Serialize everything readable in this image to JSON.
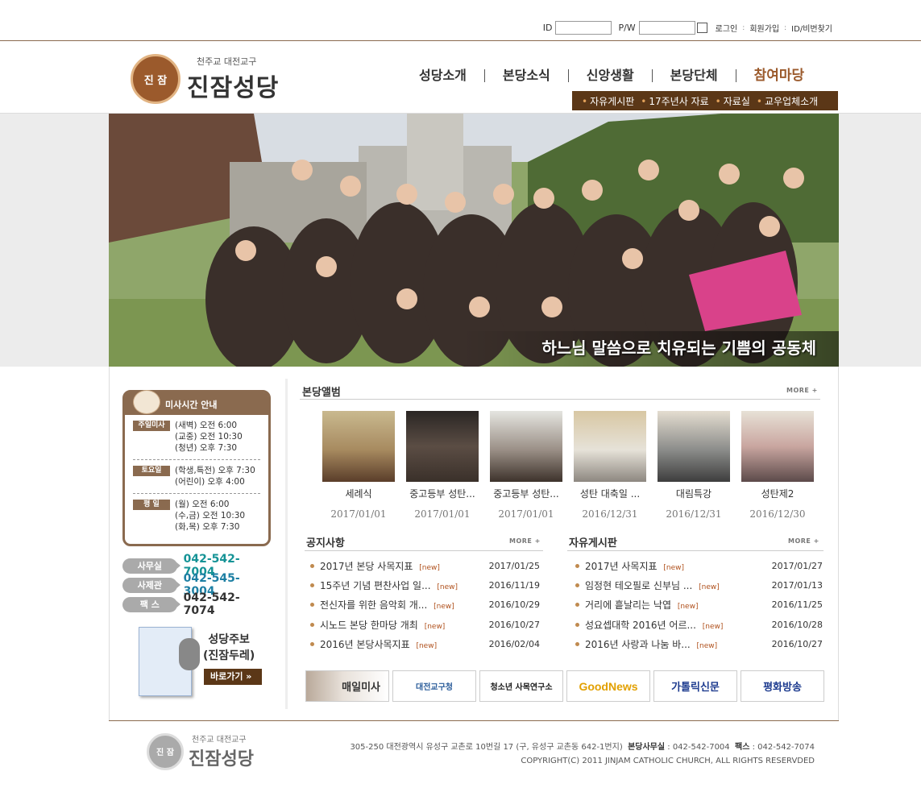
{
  "login": {
    "id_label": "ID",
    "pw_label": "P/W",
    "login": "로그인",
    "join": "회원가입",
    "find": "ID/비번찾기",
    "sep": ":"
  },
  "logo": {
    "sub": "천주교 대전교구",
    "name": "진잠성당",
    "mark": "진 잠"
  },
  "gnb": [
    "성당소개",
    "본당소식",
    "신앙생활",
    "본당단체",
    "참여마당"
  ],
  "subnav": [
    "자유게시판",
    "17주년사 자료",
    "자료실",
    "교우업체소개"
  ],
  "hero": {
    "caption": "하느님 말씀으로 치유되는 기쁨의 공동체"
  },
  "mass": {
    "title": "미사시간 안내",
    "blocks": [
      {
        "tag": "주일미사",
        "lines": [
          "(새벽) 오전 6:00",
          "(교중) 오전 10:30",
          "(청년) 오후 7:30"
        ]
      },
      {
        "tag": "토요일",
        "lines": [
          "(학생,특전) 오후 7:30",
          "(어린이) 오후 4:00"
        ]
      },
      {
        "tag": "평 일",
        "lines": [
          "(월) 오전 6:00",
          "(수,금) 오전 10:30",
          "(화,목) 오후 7:30"
        ]
      }
    ]
  },
  "contact": [
    {
      "label": "사무실",
      "number": "042-542-7004",
      "color": "#159396"
    },
    {
      "label": "사제관",
      "number": "042-545-3004",
      "color": "#1d7fa3"
    },
    {
      "label": "팩 스",
      "number": "042-542-7074",
      "color": "#333333"
    }
  ],
  "bulletin": {
    "title1": "성당주보",
    "title2": "(진잠두레)",
    "button": "바로가기 »"
  },
  "album": {
    "title": "본당앨범",
    "more": "MORE +",
    "items": [
      {
        "caption": "세례식",
        "date": "2017/01/01"
      },
      {
        "caption": "중고등부 성탄...",
        "date": "2017/01/01"
      },
      {
        "caption": "중고등부 성탄...",
        "date": "2017/01/01"
      },
      {
        "caption": "성탄 대축일 ...",
        "date": "2016/12/31"
      },
      {
        "caption": "대림특강",
        "date": "2016/12/31"
      },
      {
        "caption": "성탄제2",
        "date": "2016/12/30"
      }
    ]
  },
  "notice": {
    "title": "공지사항",
    "more": "MORE +",
    "items": [
      {
        "title": "2017년 본당 사목지표",
        "new": "[new]",
        "date": "2017/01/25"
      },
      {
        "title": "15주년 기념 편찬사업 일...",
        "new": "[new]",
        "date": "2016/11/19"
      },
      {
        "title": "전신자를 위한 음악회 개...",
        "new": "[new]",
        "date": "2016/10/29"
      },
      {
        "title": "시노드 본당 한마당 개최",
        "new": "[new]",
        "date": "2016/10/27"
      },
      {
        "title": "2016년 본당사목지표",
        "new": "[new]",
        "date": "2016/02/04"
      }
    ]
  },
  "free": {
    "title": "자유게시판",
    "more": "MORE +",
    "items": [
      {
        "title": "2017년 사목지표",
        "new": "[new]",
        "date": "2017/01/27"
      },
      {
        "title": "임정현 테오필로 신부님 ...",
        "new": "[new]",
        "date": "2017/01/13"
      },
      {
        "title": "거리에 흩날리는 낙엽",
        "new": "[new]",
        "date": "2016/11/25"
      },
      {
        "title": "성요셉대학 2016년 어르...",
        "new": "[new]",
        "date": "2016/10/28"
      },
      {
        "title": "2016년 사랑과 나눔 바...",
        "new": "[new]",
        "date": "2016/10/27"
      }
    ]
  },
  "banners": [
    "매일미사",
    "대전교구청",
    "청소년 사목연구소",
    "GoodNews",
    "가톨릭신문",
    "평화방송"
  ],
  "footer": {
    "sub": "천주교 대전교구",
    "name": "진잠성당",
    "address": "305-250 대전광역시 유성구 교촌로 10번길 17 (구, 유성구 교촌동 642-1번지)",
    "office_label": "본당사무실",
    "office": ": 042-542-7004",
    "fax_label": "팩스",
    "fax": ": 042-542-7074",
    "copyright": "COPYRIGHT(C) 2011 JINJAM CATHOLIC CHURCH, ALL RIGHTS RESERVDED"
  }
}
